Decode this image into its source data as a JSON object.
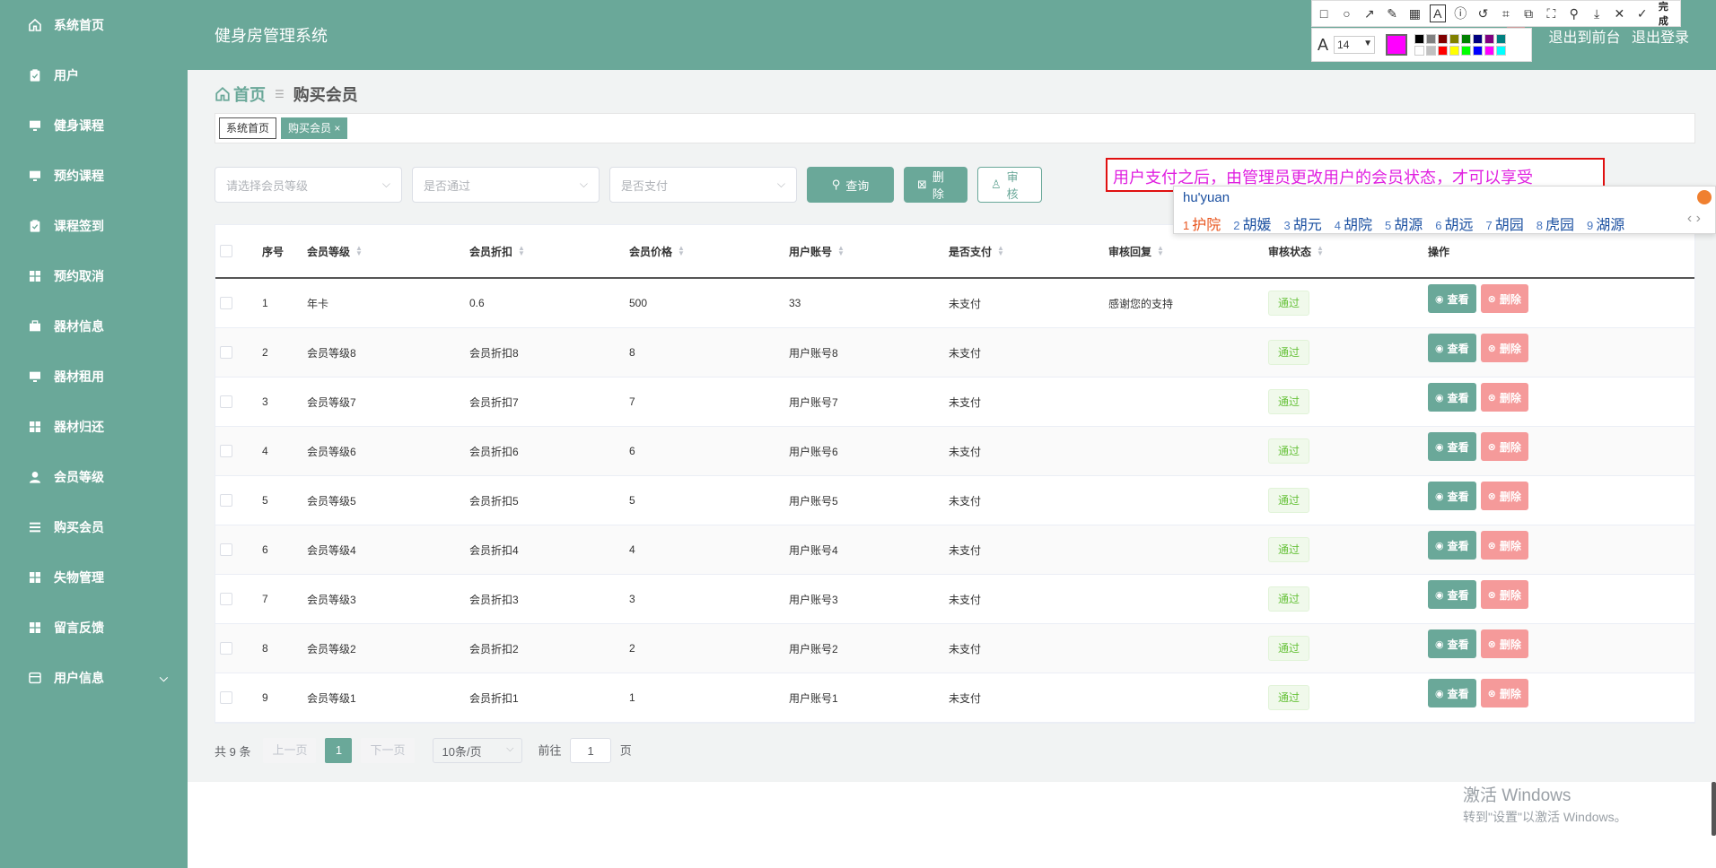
{
  "app": {
    "title": "健身房管理系统",
    "header_links": [
      "退出到前台",
      "退出登录"
    ]
  },
  "sidebar": {
    "items": [
      {
        "label": "系统首页",
        "icon": "home-icon"
      },
      {
        "label": "用户",
        "icon": "clipboard-icon"
      },
      {
        "label": "健身课程",
        "icon": "monitor-icon"
      },
      {
        "label": "预约课程",
        "icon": "monitor-icon"
      },
      {
        "label": "课程签到",
        "icon": "clipboard-icon"
      },
      {
        "label": "预约取消",
        "icon": "grid-icon"
      },
      {
        "label": "器材信息",
        "icon": "briefcase-icon"
      },
      {
        "label": "器材租用",
        "icon": "monitor-icon"
      },
      {
        "label": "器材归还",
        "icon": "grid-icon"
      },
      {
        "label": "会员等级",
        "icon": "user-icon"
      },
      {
        "label": "购买会员",
        "icon": "menu-icon"
      },
      {
        "label": "失物管理",
        "icon": "grid-icon"
      },
      {
        "label": "留言反馈",
        "icon": "grid-icon"
      },
      {
        "label": "用户信息",
        "icon": "card-icon",
        "has_children": true
      }
    ]
  },
  "breadcrumb": {
    "home": "首页",
    "current": "购买会员"
  },
  "tags": {
    "items": [
      "系统首页",
      "购买会员"
    ],
    "close_glyph": "×"
  },
  "filters": {
    "level_placeholder": "请选择会员等级",
    "approved_placeholder": "是否通过",
    "paid_placeholder": "是否支付",
    "query_label": "查询",
    "delete_label": "删除",
    "review_label": "审核"
  },
  "annotation": {
    "text": "用户支付之后，由管理员更改用户的会员状态，才可以享受"
  },
  "ime": {
    "input": "hu'yuan",
    "candidates": [
      {
        "n": "1",
        "text": "护院"
      },
      {
        "n": "2",
        "text": "胡媛"
      },
      {
        "n": "3",
        "text": "胡元"
      },
      {
        "n": "4",
        "text": "胡院"
      },
      {
        "n": "5",
        "text": "胡源"
      },
      {
        "n": "6",
        "text": "胡远"
      },
      {
        "n": "7",
        "text": "胡园"
      },
      {
        "n": "8",
        "text": "虎园"
      },
      {
        "n": "9",
        "text": "湖源"
      }
    ]
  },
  "table": {
    "headers": {
      "no": "序号",
      "level": "会员等级",
      "discount": "会员折扣",
      "price": "会员价格",
      "account": "用户账号",
      "paid": "是否支付",
      "reply": "审核回复",
      "status": "审核状态",
      "ops": "操作"
    },
    "view_label": "查看",
    "delete_label": "删除",
    "rows": [
      {
        "no": "1",
        "level": "年卡",
        "discount": "0.6",
        "price": "500",
        "account": "33",
        "paid": "未支付",
        "reply": "感谢您的支持",
        "status": "通过"
      },
      {
        "no": "2",
        "level": "会员等级8",
        "discount": "会员折扣8",
        "price": "8",
        "account": "用户账号8",
        "paid": "未支付",
        "reply": "",
        "status": "通过"
      },
      {
        "no": "3",
        "level": "会员等级7",
        "discount": "会员折扣7",
        "price": "7",
        "account": "用户账号7",
        "paid": "未支付",
        "reply": "",
        "status": "通过"
      },
      {
        "no": "4",
        "level": "会员等级6",
        "discount": "会员折扣6",
        "price": "6",
        "account": "用户账号6",
        "paid": "未支付",
        "reply": "",
        "status": "通过"
      },
      {
        "no": "5",
        "level": "会员等级5",
        "discount": "会员折扣5",
        "price": "5",
        "account": "用户账号5",
        "paid": "未支付",
        "reply": "",
        "status": "通过"
      },
      {
        "no": "6",
        "level": "会员等级4",
        "discount": "会员折扣4",
        "price": "4",
        "account": "用户账号4",
        "paid": "未支付",
        "reply": "",
        "status": "通过"
      },
      {
        "no": "7",
        "level": "会员等级3",
        "discount": "会员折扣3",
        "price": "3",
        "account": "用户账号3",
        "paid": "未支付",
        "reply": "",
        "status": "通过"
      },
      {
        "no": "8",
        "level": "会员等级2",
        "discount": "会员折扣2",
        "price": "2",
        "account": "用户账号2",
        "paid": "未支付",
        "reply": "",
        "status": "通过"
      },
      {
        "no": "9",
        "level": "会员等级1",
        "discount": "会员折扣1",
        "price": "1",
        "account": "用户账号1",
        "paid": "未支付",
        "reply": "",
        "status": "通过"
      }
    ]
  },
  "pager": {
    "total": "共 9 条",
    "prev": "上一页",
    "page": "1",
    "next": "下一页",
    "page_size": "10条/页",
    "goto": "前往",
    "goto_value": "1",
    "page_unit": "页"
  },
  "watermark": {
    "line1": "激活 Windows",
    "line2": "转到\"设置\"以激活 Windows。"
  },
  "snip": {
    "done_label": "完成",
    "font_size": "14",
    "current_color": "#ff00ff",
    "palette": [
      "#000000",
      "#808080",
      "#800000",
      "#808000",
      "#008000",
      "#000080",
      "#800080",
      "#008080",
      "#ffffff",
      "#c0c0c0",
      "#ff0000",
      "#ffff00",
      "#00ff00",
      "#0000ff",
      "#ff00ff",
      "#00ffff"
    ]
  },
  "colors": {
    "accent": "#6aa899",
    "danger": "#f59a9a",
    "success": "#67c23a"
  }
}
